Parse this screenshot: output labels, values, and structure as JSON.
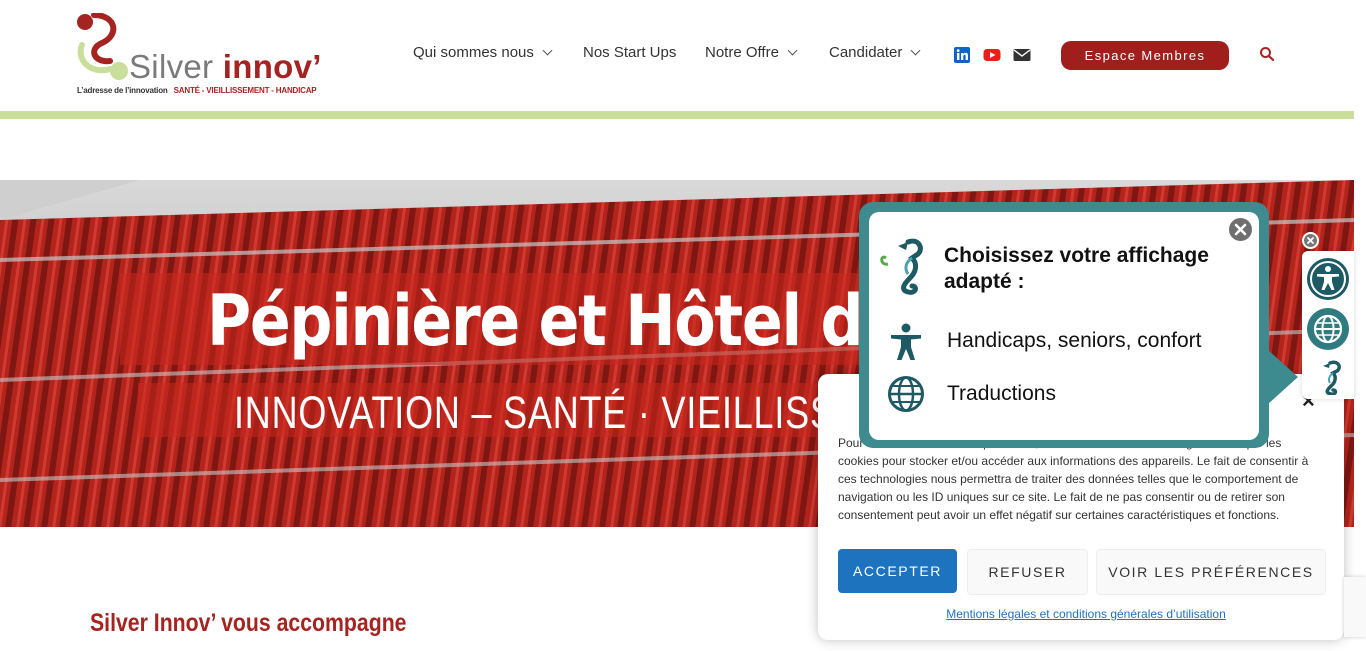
{
  "logo": {
    "brand_light": "Silver",
    "brand_bold": "innov’",
    "tagline_left": "L’adresse de l’innovation",
    "tagline_right": "SANTÉ - VIEILLISSEMENT - HANDICAP"
  },
  "nav": {
    "items": [
      {
        "label": "Qui sommes nous",
        "has_dropdown": true
      },
      {
        "label": "Nos Start Ups",
        "has_dropdown": false
      },
      {
        "label": "Notre Offre",
        "has_dropdown": true
      },
      {
        "label": "Candidater",
        "has_dropdown": true
      }
    ],
    "social": [
      {
        "icon": "linkedin-icon",
        "color": "#0a66c2"
      },
      {
        "icon": "youtube-icon",
        "color": "#e62117"
      },
      {
        "icon": "mail-icon",
        "color": "#333333"
      }
    ],
    "members_button": "Espace Membres",
    "search_icon": "search-icon"
  },
  "hero": {
    "title": "Pépinière et Hôtel d’En",
    "subtitle": "INNOVATION – SANTÉ · VIEILLISSE"
  },
  "section": {
    "title": "Silver Innov’ vous accompagne"
  },
  "cookie": {
    "text": "Pour offrir les meilleures expériences, nous utilisons des technologies telles que les cookies pour stocker et/ou accéder aux informations des appareils. Le fait de consentir à ces technologies nous permettra de traiter des données telles que le comportement de navigation ou les ID uniques sur ce site. Le fait de ne pas consentir ou de retirer son consentement peut avoir un effet négatif sur certaines caractéristiques et fonctions.",
    "accept": "ACCEPTER",
    "refuse": "REFUSER",
    "preferences": "VOIR LES PRÉFÉRENCES",
    "legal_link": "Mentions légales et conditions générales d’utilisation",
    "close": "×"
  },
  "accessibility": {
    "title": "Choisissez votre affichage adapté :",
    "options": [
      {
        "label": "Handicaps, seniors, confort",
        "icon": "person-icon"
      },
      {
        "label": "Traductions",
        "icon": "globe-icon"
      }
    ]
  },
  "colors": {
    "brand_red": "#a52422",
    "brand_green": "#c9de9a",
    "teal": "#3d8a8f",
    "dark_teal": "#1e5a63",
    "link_blue": "#1e73be"
  }
}
